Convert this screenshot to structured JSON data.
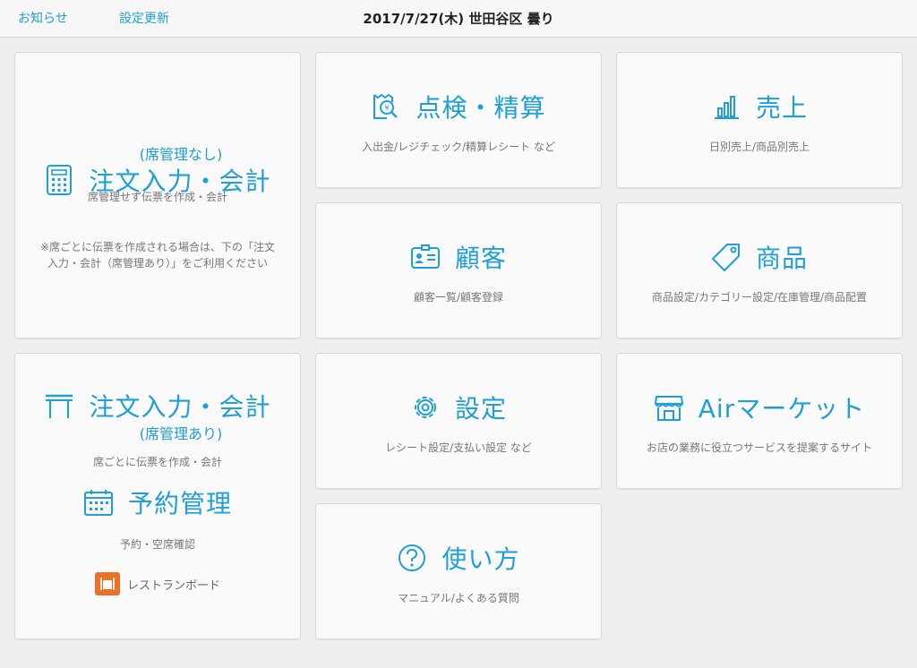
{
  "header": {
    "notice_label": "お知らせ",
    "settings_update_label": "設定更新",
    "title": "2017/7/27(木) 世田谷区 曇り"
  },
  "cards": {
    "order_no_seat": {
      "title": "注文入力・会計",
      "subtitle": "(席管理なし)",
      "desc": "席管理せず伝票を作成・会計",
      "note": "※席ごとに伝票を作成される場合は、下の「注文入力・会計（席管理あり）」をご利用ください",
      "icon": "calculator-icon"
    },
    "inspection": {
      "title": "点検・精算",
      "desc": "入出金/レジチェック/精算レシート など",
      "icon": "receipt-search-icon"
    },
    "sales": {
      "title": "売上",
      "desc": "日別売上/商品別売上",
      "icon": "bar-chart-icon"
    },
    "customers": {
      "title": "顧客",
      "desc": "顧客一覧/顧客登録",
      "icon": "customer-card-icon"
    },
    "products": {
      "title": "商品",
      "desc": "商品設定/カテゴリー設定/在庫管理/商品配置",
      "icon": "tag-icon"
    },
    "order_with_seat": {
      "title": "注文入力・会計",
      "subtitle": "(席管理あり)",
      "desc": "席ごとに伝票を作成・会計",
      "icon": "table-icon",
      "reservation_title": "予約管理",
      "reservation_desc": "予約・空席確認",
      "reservation_icon": "calendar-icon",
      "restaurant_board_label": "レストランボード",
      "restaurant_board_icon": "restaurant-board-icon"
    },
    "settings": {
      "title": "設定",
      "desc": "レシート設定/支払い設定 など",
      "icon": "gear-icon"
    },
    "air_market": {
      "title": "Airマーケット",
      "desc": "お店の業務に役立つサービスを提案するサイト",
      "icon": "storefront-icon"
    },
    "how_to": {
      "title": "使い方",
      "desc": "マニュアル/よくある質問",
      "icon": "question-icon"
    }
  },
  "colors": {
    "accent": "#1e9fd9",
    "text_muted": "#777777",
    "background": "#efefef",
    "card": "#fafafa",
    "restaurant_board": "#e9722a"
  }
}
